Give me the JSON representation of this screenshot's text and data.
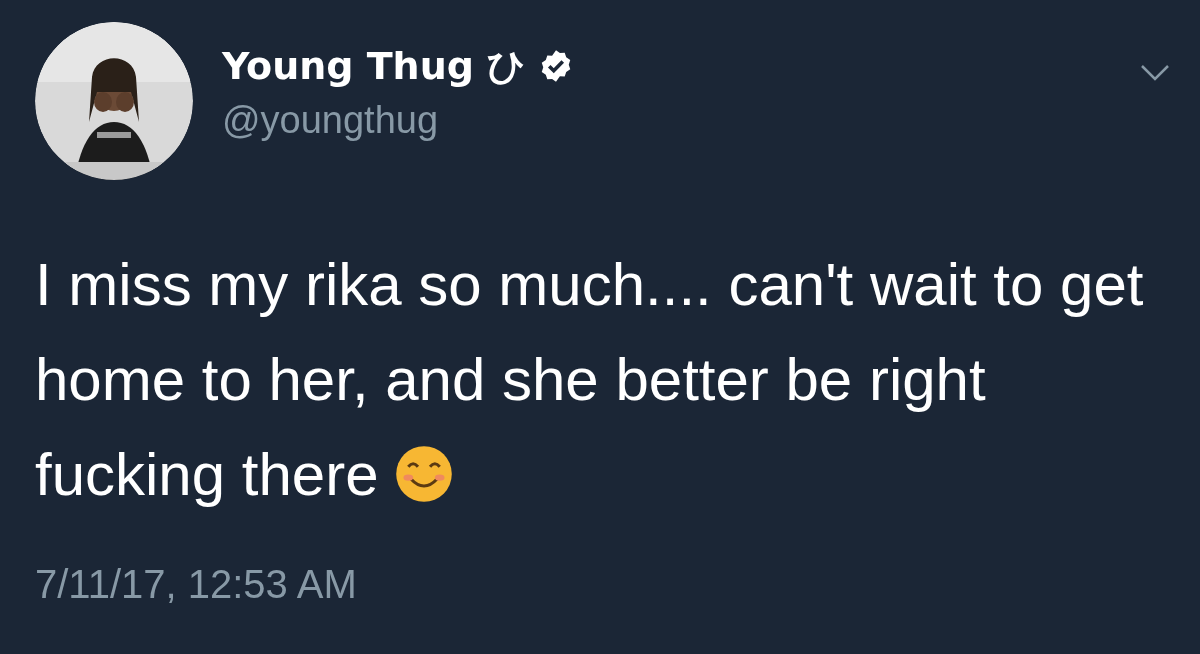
{
  "tweet": {
    "display_name": "Young Thug ひ",
    "verified": true,
    "handle": "@youngthug",
    "text": "I miss my rika so much.... can't wait to get home to her, and she better be right fucking there",
    "timestamp": "7/11/17, 12:53 AM"
  }
}
